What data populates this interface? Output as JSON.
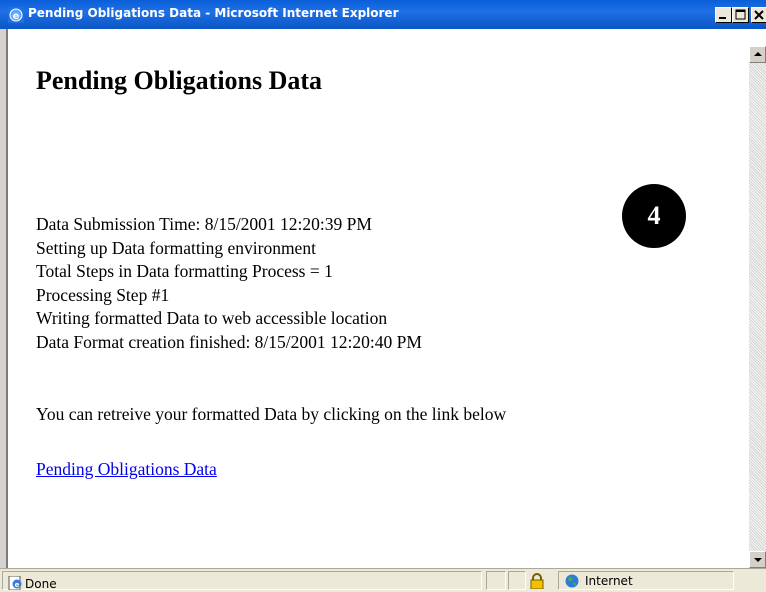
{
  "window": {
    "title": "Pending Obligations Data - Microsoft Internet Explorer"
  },
  "page": {
    "heading": "Pending Obligations Data",
    "log_lines": [
      "Data Submission Time: 8/15/2001 12:20:39 PM",
      "Setting up Data formatting environment",
      "Total Steps in Data formatting Process = 1",
      "Processing Step #1",
      "Writing formatted Data to web accessible location",
      "Data Format creation finished: 8/15/2001 12:20:40 PM"
    ],
    "instruction": "You can retreive your formatted Data by clicking on the link below",
    "link_text": "Pending Obligations Data"
  },
  "badge": {
    "step_number": "4"
  },
  "statusbar": {
    "status": "Done",
    "zone": "Internet"
  },
  "icons": {
    "app": "ie-icon",
    "minimize": "minimize-icon",
    "maximize": "maximize-icon",
    "close": "close-icon",
    "page": "page-icon",
    "lock": "lock-icon",
    "zone": "globe-icon"
  },
  "colors": {
    "titlebar": "#0a5fd8",
    "link": "#0000ee",
    "badge": "#000000",
    "chrome": "#ece9d8"
  }
}
